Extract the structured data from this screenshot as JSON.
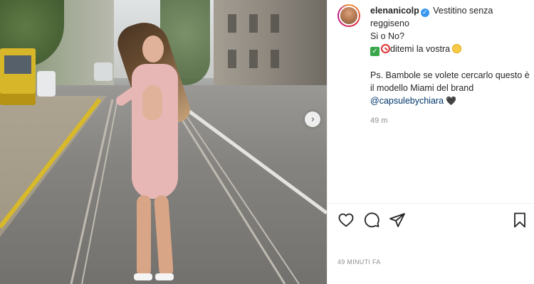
{
  "post": {
    "photo_alt": "Photo",
    "carousel_next_glyph": "›"
  },
  "comment": {
    "username": "elenanicolp",
    "caption_line1": "Vestitino senza reggiseno",
    "caption_line2": "Si o No?",
    "caption_line3": "ditemi la vostra",
    "caption_line4": "Ps. Bambole se volete cercarlo questo è il modello Miami del brand",
    "mention": "@capsulebychiara",
    "heart": "🖤",
    "time": "49 m"
  },
  "actions": {
    "like_icon": "heart-icon",
    "comment_icon": "comment-icon",
    "share_icon": "share-icon",
    "save_icon": "bookmark-icon"
  },
  "footer": {
    "timestamp": "49 MINUTI FA"
  },
  "colors": {
    "verified": "#3897f0",
    "mention": "#00376b",
    "muted": "#8e8e8e"
  }
}
